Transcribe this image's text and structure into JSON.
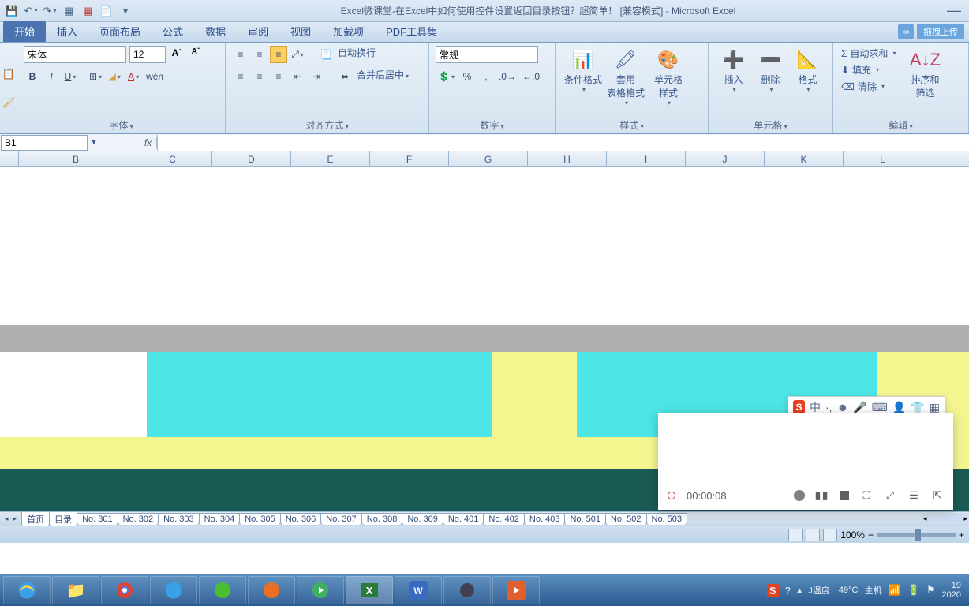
{
  "title": "Excel微课堂-在Excel中如何使用控件设置返回目录按钮？超简单！  [兼容模式] - Microsoft Excel",
  "tabs": [
    "开始",
    "插入",
    "页面布局",
    "公式",
    "数据",
    "审阅",
    "视图",
    "加载项",
    "PDF工具集"
  ],
  "upload_label": "拖拽上传",
  "ribbon": {
    "font_name": "宋体",
    "font_size": "12",
    "font_group": "字体",
    "align_group": "对齐方式",
    "wrap": "自动换行",
    "merge": "合并后居中",
    "number_format": "常规",
    "number_group": "数字",
    "cond_fmt": "条件格式",
    "table_fmt": "套用\n表格格式",
    "cell_style": "单元格\n样式",
    "style_group": "样式",
    "insert": "插入",
    "delete": "删除",
    "format": "格式",
    "cell_group": "单元格",
    "autosum": "自动求和",
    "fill": "填充",
    "clear": "清除",
    "edit_group": "编辑",
    "sort_filter": "排序和\n筛选"
  },
  "namebox": "B1",
  "columns": [
    "B",
    "C",
    "D",
    "E",
    "F",
    "G",
    "H",
    "I",
    "J",
    "K",
    "L"
  ],
  "sheets": [
    "首页",
    "目录",
    "No. 301",
    "No. 302",
    "No. 303",
    "No. 304",
    "No. 305",
    "No. 306",
    "No. 307",
    "No. 308",
    "No. 309",
    "No. 401",
    "No. 402",
    "No. 403",
    "No. 501",
    "No. 502",
    "No. 503"
  ],
  "zoom": "100%",
  "ime": {
    "lang": "中"
  },
  "recorder_time": "00:00:08",
  "tray": {
    "temp_label": "J温度:",
    "temp": "49°C",
    "host": "主机",
    "time": "19",
    "date": "2020"
  }
}
